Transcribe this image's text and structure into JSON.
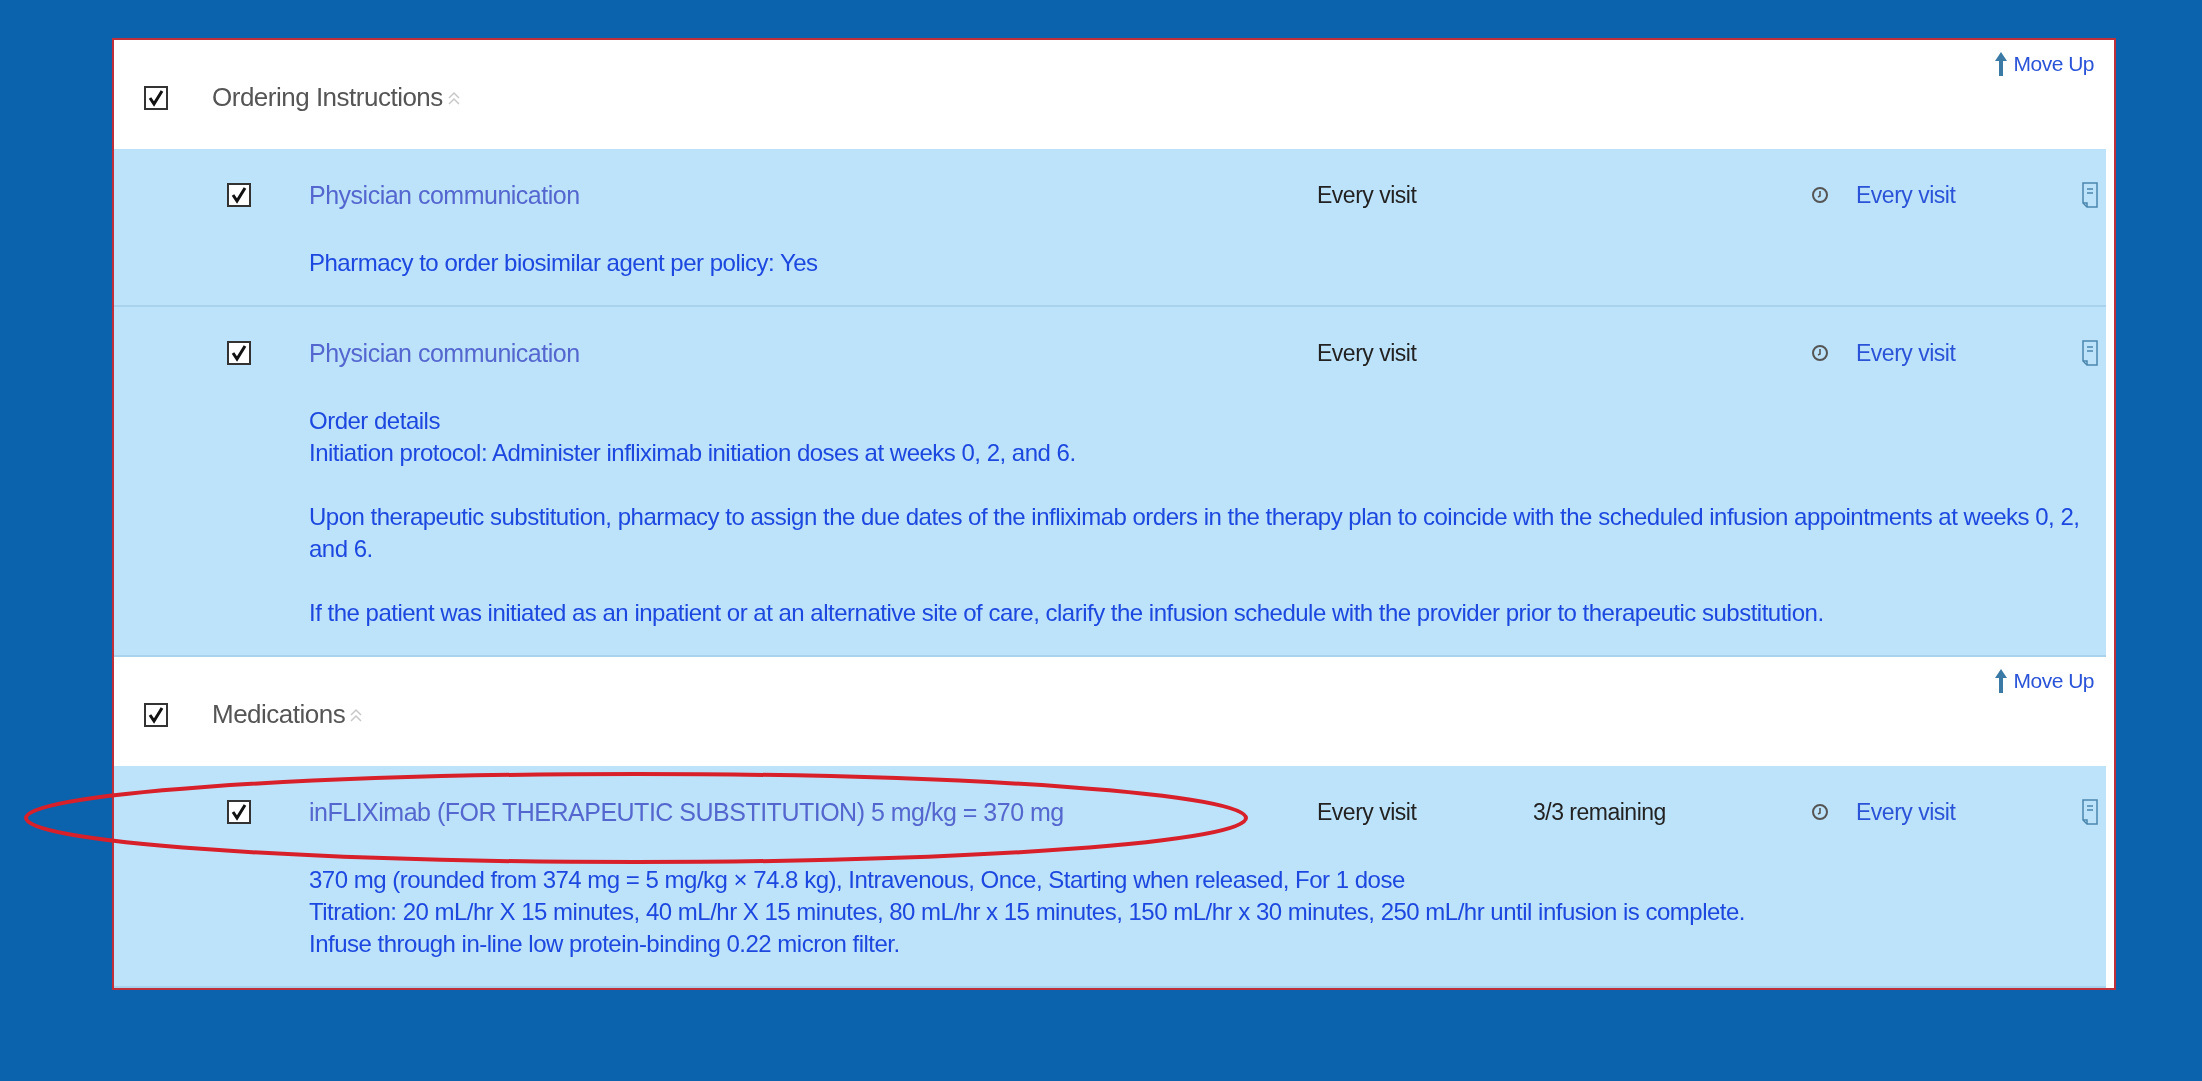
{
  "sections": [
    {
      "title": "Ordering Instructions",
      "checked": true,
      "move_up": "Move Up",
      "orders": [
        {
          "checked": true,
          "highlighted": false,
          "name": "Physician communication",
          "frequency": "Every visit",
          "schedule": "Every visit",
          "details": [
            [
              "Pharmacy to order biosimilar agent per policy: Yes"
            ]
          ]
        },
        {
          "checked": true,
          "highlighted": false,
          "name": "Physician communication",
          "frequency": "Every visit",
          "schedule": "Every visit",
          "details": [
            [
              "Order details",
              "Initiation protocol: Administer infliximab initiation doses at weeks 0, 2, and 6."
            ],
            [
              "Upon therapeutic substitution, pharmacy to assign the due dates of the infliximab orders in the therapy plan to coincide with the scheduled infusion appointments at weeks 0, 2, and 6."
            ],
            [
              "If the patient was initiated as an inpatient or at an alternative site of care, clarify the infusion schedule with the provider prior to therapeutic substitution."
            ]
          ]
        }
      ]
    },
    {
      "title": "Medications",
      "checked": true,
      "move_up": "Move Up",
      "orders": [
        {
          "checked": true,
          "highlighted": true,
          "name": "inFLIXimab (FOR THERAPEUTIC SUBSTITUTION) 5 mg/kg = 370 mg",
          "frequency": "Every visit",
          "remaining": "3/3 remaining",
          "schedule": "Every visit",
          "details": [
            [
              "370 mg (rounded from 374 mg = 5 mg/kg × 74.8 kg), Intravenous, Once, Starting when released, For 1 dose",
              "Titration: 20 mL/hr X 15 minutes, 40 mL/hr X 15 minutes, 80 mL/hr x 15 minutes, 150 mL/hr x 30 minutes, 250 mL/hr until infusion is complete.",
              "Infuse through in-line low protein-binding 0.22 micron filter."
            ]
          ]
        }
      ]
    }
  ]
}
